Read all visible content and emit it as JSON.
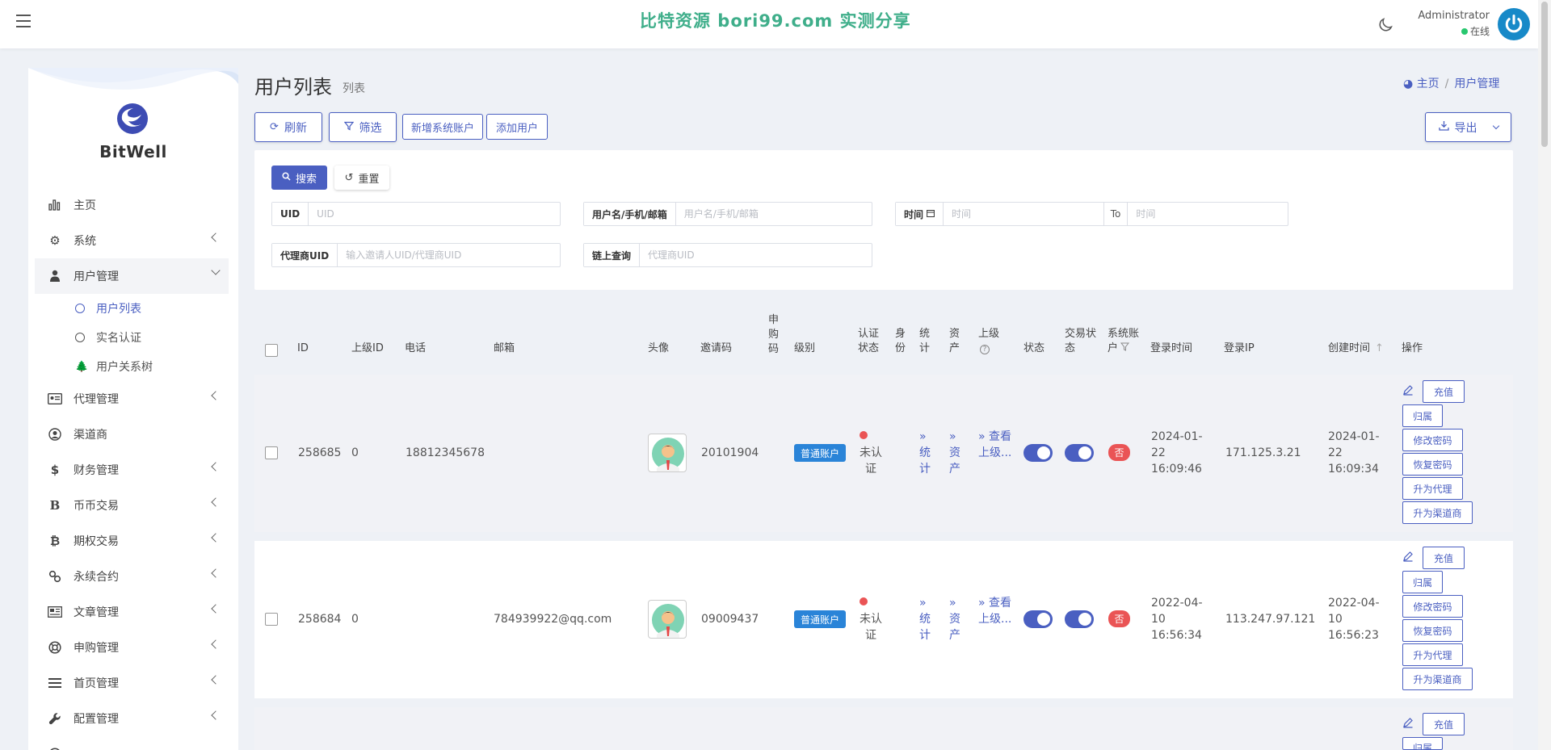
{
  "header": {
    "watermark": "比特资源 bori99.com 实测分享",
    "user_name": "Administrator",
    "user_status": "在线"
  },
  "sidebar": {
    "brand": "BitWell",
    "items": [
      {
        "label": "主页",
        "icon": "bar-chart-icon"
      },
      {
        "label": "系统",
        "icon": "gear-icon"
      },
      {
        "label": "用户管理",
        "icon": "user-tie-icon"
      },
      {
        "label": "代理管理",
        "icon": "id-card-icon"
      },
      {
        "label": "渠道商",
        "icon": "user-circle-icon"
      },
      {
        "label": "财务管理",
        "icon": "dollar-icon"
      },
      {
        "label": "币币交易",
        "icon": "letter-b-icon"
      },
      {
        "label": "期权交易",
        "icon": "bitcoin-icon"
      },
      {
        "label": "永续合约",
        "icon": "link-icon"
      },
      {
        "label": "文章管理",
        "icon": "newspaper-icon"
      },
      {
        "label": "申购管理",
        "icon": "lifebuoy-icon"
      },
      {
        "label": "首页管理",
        "icon": "list-icon"
      },
      {
        "label": "配置管理",
        "icon": "wrench-icon"
      }
    ],
    "sub_items": [
      {
        "label": "用户列表"
      },
      {
        "label": "实名认证"
      },
      {
        "label": "用户关系树"
      }
    ]
  },
  "page": {
    "title": "用户列表",
    "subtitle": "列表",
    "breadcrumb_home": "主页",
    "breadcrumb_current": "用户管理"
  },
  "toolbar": {
    "refresh": "刷新",
    "filter": "筛选",
    "add_system": "新增系统账户",
    "add_user": "添加用户",
    "export": "导出"
  },
  "filter": {
    "search": "搜索",
    "reset": "重置",
    "uid_label": "UID",
    "uid_placeholder": "UID",
    "user_label": "用户名/手机/邮箱",
    "user_placeholder": "用户名/手机/邮箱",
    "time_label": "时间",
    "time_placeholder": "时间",
    "to_label": "To",
    "time_to_placeholder": "时间",
    "agent_label": "代理商UID",
    "agent_placeholder": "输入邀请人UID/代理商UID",
    "chain_label": "链上查询",
    "chain_placeholder": "代理商UID"
  },
  "table": {
    "headers": {
      "id": "ID",
      "parent_id": "上级ID",
      "phone": "电话",
      "email": "邮箱",
      "avatar": "头像",
      "invite_code": "邀请码",
      "purchase_code": "申购码",
      "level": "级别",
      "auth_status": "认证状态",
      "identity": "身份",
      "stats": "统计",
      "assets": "资产",
      "superior": "上级",
      "status": "状态",
      "trade_status": "交易状态",
      "system_account": "系统账户",
      "login_time": "登录时间",
      "login_ip": "登录IP",
      "created_time": "创建时间",
      "actions": "操作"
    },
    "rows": [
      {
        "id": "258685",
        "parent_id": "0",
        "phone": "18812345678",
        "email": "",
        "invite_code": "20101904",
        "level": "普通账户",
        "auth": "未认证",
        "stats": "» 统计",
        "assets": "» 资产",
        "superior": "» 查看上级...",
        "system_account": "否",
        "login_time": "2024-01-22 16:09:46",
        "login_ip": "171.125.3.21",
        "created_time": "2024-01-22 16:09:34"
      },
      {
        "id": "258684",
        "parent_id": "0",
        "phone": "",
        "email": "784939922@qq.com",
        "invite_code": "09009437",
        "level": "普通账户",
        "auth": "未认证",
        "stats": "» 统计",
        "assets": "» 资产",
        "superior": "» 查看上级...",
        "system_account": "否",
        "login_time": "2022-04-10 16:56:34",
        "login_ip": "113.247.97.121",
        "created_time": "2022-04-10 16:56:23"
      }
    ],
    "actions": {
      "recharge": "充值",
      "belong": "归属",
      "change_pwd": "修改密码",
      "restore_pwd": "恢复密码",
      "to_agent": "升为代理",
      "to_channel": "升为渠道商"
    }
  },
  "colors": {
    "accent": "#4a5fc1",
    "badge_blue": "#2a84d8",
    "danger": "#ea5455",
    "online": "#28c76f",
    "watermark": "#3fae8a"
  }
}
